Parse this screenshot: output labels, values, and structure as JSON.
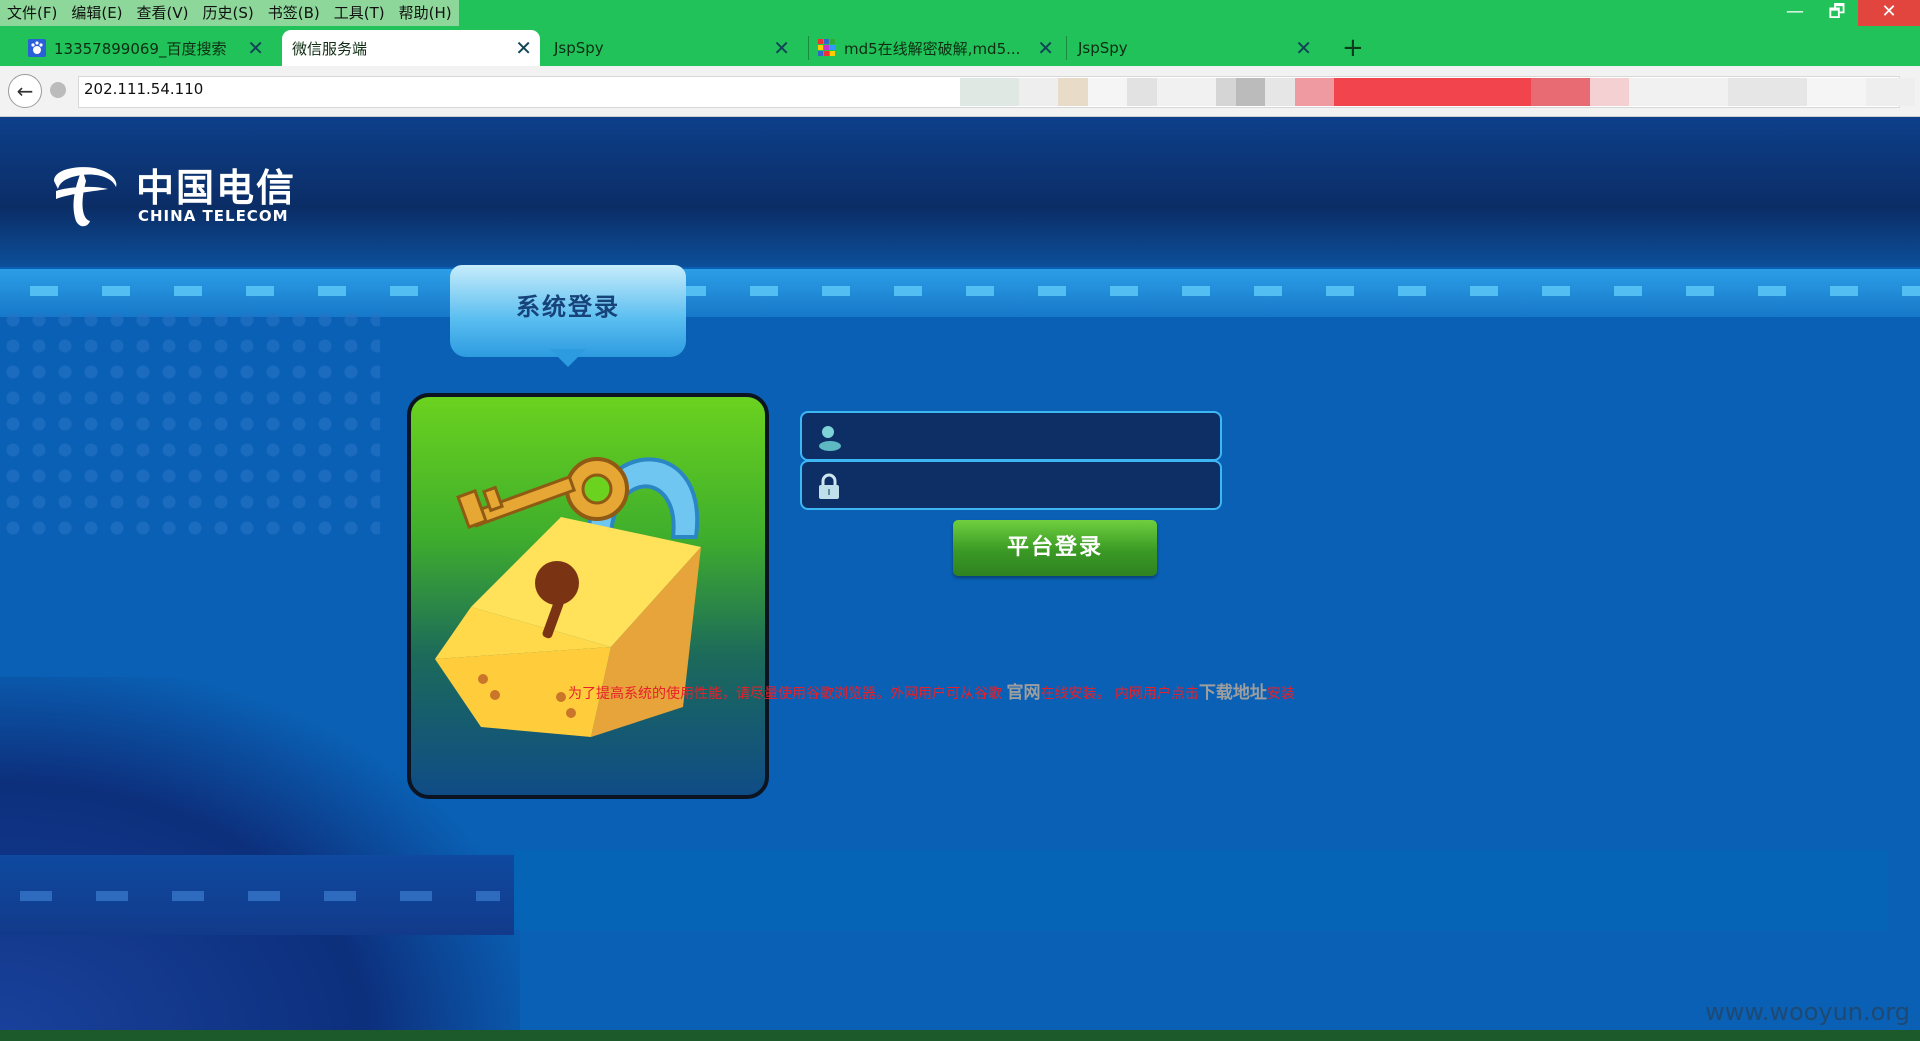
{
  "menubar": {
    "items": [
      "文件(F)",
      "编辑(E)",
      "查看(V)",
      "历史(S)",
      "书签(B)",
      "工具(T)",
      "帮助(H)"
    ]
  },
  "window_controls": {
    "minimize": "—",
    "maximize": "🗗",
    "close": "✕"
  },
  "tabs": [
    {
      "title": "13357899069_百度搜索",
      "icon": "baidu-paw-icon"
    },
    {
      "title": "微信服务端",
      "icon": "none",
      "active": true
    },
    {
      "title": "JspSpy",
      "icon": "none"
    },
    {
      "title": "md5在线解密破解,md5...",
      "icon": "grid-icon"
    },
    {
      "title": "JspSpy",
      "icon": "none"
    }
  ],
  "new_tab": "+",
  "address": {
    "url": "202.111.54.110"
  },
  "logo": {
    "cn": "中国电信",
    "en": "CHINA TELECOM"
  },
  "login": {
    "section_title": "系统登录",
    "username_icon": "user-icon",
    "password_icon": "lock-icon",
    "button": "平台登录"
  },
  "notice": {
    "part1": "为了提高系统的使用性能，请尽量使用谷歌浏览器。外网用户可从谷歌 ",
    "link1": "官网",
    "part2": "在线安装。 内网用户点击",
    "link2": "下载地址",
    "part3": "安装"
  },
  "watermark": "www.wooyun.org",
  "colors": {
    "chrome_green": "#22c25a",
    "page_blue": "#0a60b4",
    "button_green": "#3a9a25",
    "notice_red": "#e8202a"
  }
}
